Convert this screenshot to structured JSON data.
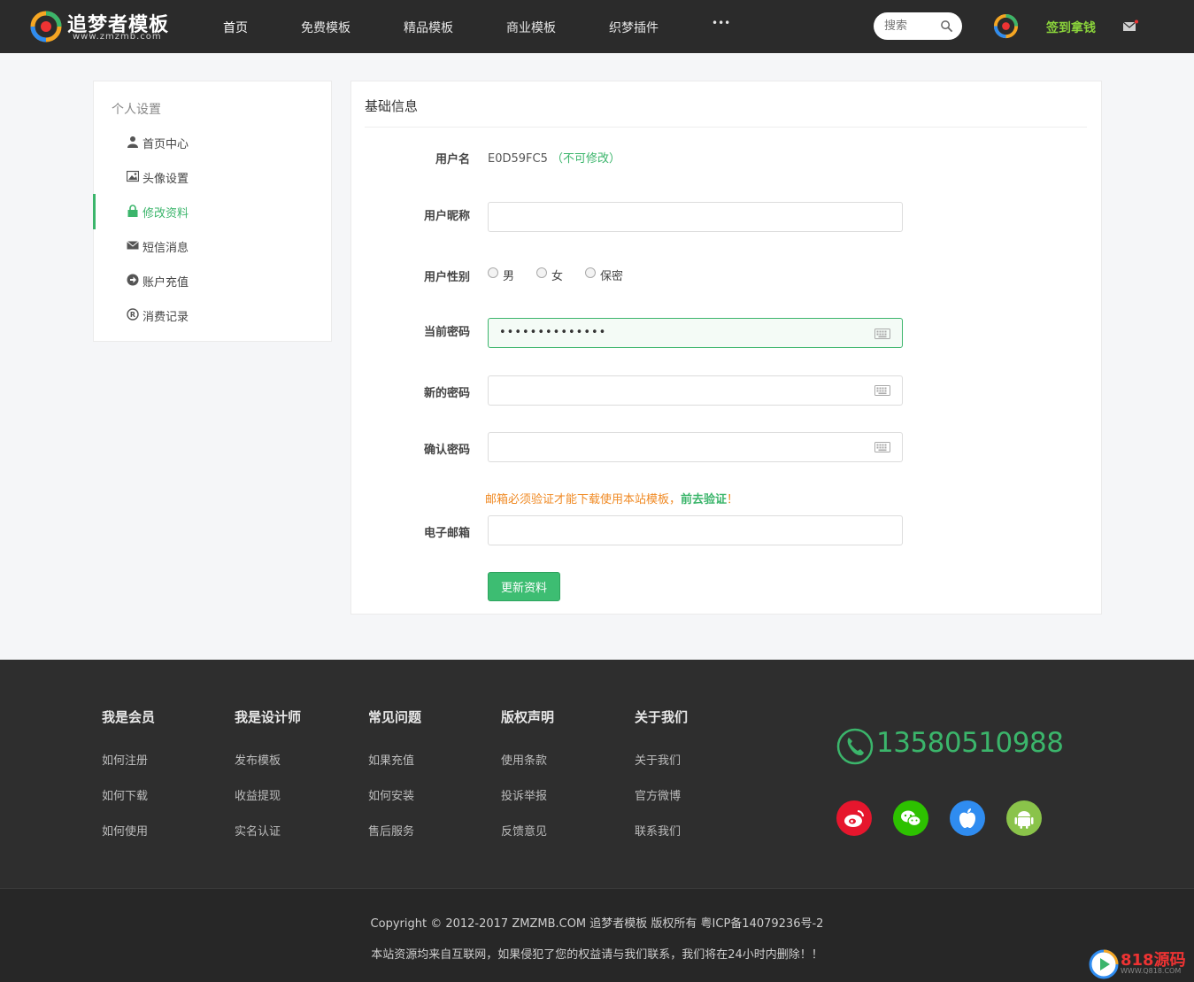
{
  "brand": {
    "title": "追梦者模板",
    "subtitle": "www.zmzmb.com"
  },
  "nav": {
    "items": [
      {
        "label": "首页",
        "active": true
      },
      {
        "label": "免费模板"
      },
      {
        "label": "精品模板"
      },
      {
        "label": "商业模板"
      },
      {
        "label": "织梦插件"
      }
    ],
    "more": "•••"
  },
  "header": {
    "search_placeholder": "搜索",
    "sign_in": "签到拿钱"
  },
  "sidebar": {
    "title": "个人设置",
    "items": [
      {
        "label": "首页中心",
        "icon": "user-icon"
      },
      {
        "label": "头像设置",
        "icon": "image-icon"
      },
      {
        "label": "修改资料",
        "icon": "lock-icon",
        "active": true
      },
      {
        "label": "短信消息",
        "icon": "envelope-icon"
      },
      {
        "label": "账户充值",
        "icon": "circle-arrow-icon"
      },
      {
        "label": "消费记录",
        "icon": "registered-icon"
      }
    ]
  },
  "form": {
    "title": "基础信息",
    "username_label": "用户名",
    "username_value": "E0D59FC5",
    "username_note": "（不可修改）",
    "nickname_label": "用户昵称",
    "nickname_value": "",
    "gender_label": "用户性别",
    "gender_options": [
      "男",
      "女",
      "保密"
    ],
    "current_password_label": "当前密码",
    "current_password_value": "••••••••••••••",
    "new_password_label": "新的密码",
    "confirm_password_label": "确认密码",
    "email_warning": "邮箱必须验证才能下载使用本站模板，",
    "email_verify_link": "前去验证",
    "email_warning_end": "！",
    "email_label": "电子邮箱",
    "email_value": "",
    "submit_label": "更新资料"
  },
  "footer": {
    "columns": [
      {
        "title": "我是会员",
        "links": [
          "如何注册",
          "如何下载",
          "如何使用"
        ]
      },
      {
        "title": "我是设计师",
        "links": [
          "发布模板",
          "收益提现",
          "实名认证"
        ]
      },
      {
        "title": "常见问题",
        "links": [
          "如果充值",
          "如何安装",
          "售后服务"
        ]
      },
      {
        "title": "版权声明",
        "links": [
          "使用条款",
          "投诉举报",
          "反馈意见"
        ]
      },
      {
        "title": "关于我们",
        "links": [
          "关于我们",
          "官方微博",
          "联系我们"
        ]
      }
    ],
    "phone": "13580510988",
    "social": [
      {
        "icon": "weibo-icon",
        "color": "#e6162d"
      },
      {
        "icon": "wechat-icon",
        "color": "#2dc100"
      },
      {
        "icon": "apple-icon",
        "color": "#2f8cf0"
      },
      {
        "icon": "android-icon",
        "color": "#8ac34a"
      }
    ],
    "copyright": "Copyright © 2012-2017 ZMZMB.COM 追梦者模板 版权所有 粤ICP备14079236号-2",
    "disclaimer": "本站资源均来自互联网，如果侵犯了您的权益请与我们联系，我们将在24小时内删除！！"
  },
  "watermark": {
    "text": "818源码",
    "sub": "WWW.Q818.COM"
  },
  "colors": {
    "accent": "#3bb56b",
    "header_bg": "#2b2b2b",
    "footer_bg": "#2e2e2e",
    "warning": "#f08a24"
  }
}
